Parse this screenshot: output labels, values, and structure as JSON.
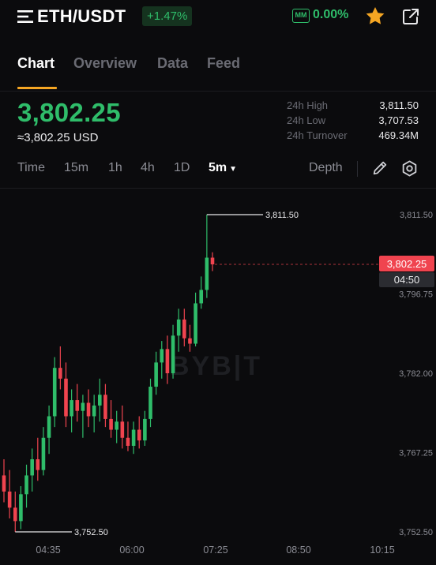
{
  "header": {
    "pair": "ETH/USDT",
    "change_pct": "+1.47%",
    "mm_label": "MM",
    "mm_value": "0.00%",
    "icons": [
      "menu-icon",
      "star-icon",
      "share-icon"
    ]
  },
  "tabs": [
    {
      "label": "Chart",
      "active": true
    },
    {
      "label": "Overview",
      "active": false
    },
    {
      "label": "Data",
      "active": false
    },
    {
      "label": "Feed",
      "active": false
    }
  ],
  "price": {
    "last": "3,802.25",
    "usd": "≈3,802.25 USD"
  },
  "stats": [
    {
      "label": "24h High",
      "value": "3,811.50"
    },
    {
      "label": "24h Low",
      "value": "3,707.53"
    },
    {
      "label": "24h Turnover",
      "value": "469.34M"
    }
  ],
  "toolbar": {
    "timeframes": [
      {
        "label": "Time",
        "active": false
      },
      {
        "label": "15m",
        "active": false
      },
      {
        "label": "1h",
        "active": false
      },
      {
        "label": "4h",
        "active": false
      },
      {
        "label": "1D",
        "active": false
      },
      {
        "label": "5m",
        "active": true
      }
    ],
    "depth_label": "Depth"
  },
  "colors": {
    "up": "#2fbd6a",
    "down": "#f0444f",
    "accent": "#f5a623",
    "background": "#0b0b0d"
  },
  "watermark": "BYB|T",
  "chart_data": {
    "type": "candlestick",
    "y_ticks": [
      "3,811.50",
      "3,796.75",
      "3,782.00",
      "3,767.25",
      "3,752.50"
    ],
    "y_tick_values": [
      3811.5,
      3796.75,
      3782.0,
      3767.25,
      3752.5
    ],
    "ylim": [
      3752.5,
      3811.5
    ],
    "x_ticks": [
      "04:35",
      "06:00",
      "07:25",
      "08:50",
      "10:15"
    ],
    "high_marker": "3,811.50",
    "low_marker": "3,752.50",
    "current_price_label": "3,802.25",
    "countdown": "04:50",
    "grid": false,
    "candles": [
      {
        "o": 3763.0,
        "h": 3766.0,
        "l": 3758.0,
        "c": 3760.0
      },
      {
        "o": 3760.0,
        "h": 3764.0,
        "l": 3755.0,
        "c": 3757.0
      },
      {
        "o": 3757.0,
        "h": 3760.0,
        "l": 3752.5,
        "c": 3754.5
      },
      {
        "o": 3754.5,
        "h": 3761.0,
        "l": 3753.0,
        "c": 3759.5
      },
      {
        "o": 3759.5,
        "h": 3765.0,
        "l": 3757.0,
        "c": 3763.0
      },
      {
        "o": 3763.0,
        "h": 3768.0,
        "l": 3760.0,
        "c": 3766.0
      },
      {
        "o": 3766.0,
        "h": 3770.0,
        "l": 3762.0,
        "c": 3764.0
      },
      {
        "o": 3764.0,
        "h": 3772.0,
        "l": 3763.0,
        "c": 3770.0
      },
      {
        "o": 3770.0,
        "h": 3776.0,
        "l": 3767.0,
        "c": 3774.0
      },
      {
        "o": 3774.0,
        "h": 3785.0,
        "l": 3772.0,
        "c": 3783.0
      },
      {
        "o": 3783.0,
        "h": 3787.0,
        "l": 3779.0,
        "c": 3781.0
      },
      {
        "o": 3781.0,
        "h": 3784.0,
        "l": 3772.0,
        "c": 3774.0
      },
      {
        "o": 3774.0,
        "h": 3779.0,
        "l": 3771.0,
        "c": 3777.0
      },
      {
        "o": 3777.0,
        "h": 3780.0,
        "l": 3773.0,
        "c": 3775.0
      },
      {
        "o": 3775.0,
        "h": 3778.0,
        "l": 3770.0,
        "c": 3776.5
      },
      {
        "o": 3776.5,
        "h": 3779.0,
        "l": 3772.0,
        "c": 3774.0
      },
      {
        "o": 3774.0,
        "h": 3778.0,
        "l": 3771.0,
        "c": 3776.0
      },
      {
        "o": 3776.0,
        "h": 3781.0,
        "l": 3773.0,
        "c": 3778.0
      },
      {
        "o": 3778.0,
        "h": 3780.0,
        "l": 3772.0,
        "c": 3773.5
      },
      {
        "o": 3773.5,
        "h": 3777.0,
        "l": 3770.0,
        "c": 3771.5
      },
      {
        "o": 3771.5,
        "h": 3775.0,
        "l": 3769.0,
        "c": 3773.0
      },
      {
        "o": 3773.0,
        "h": 3776.0,
        "l": 3768.0,
        "c": 3770.0
      },
      {
        "o": 3770.0,
        "h": 3773.0,
        "l": 3767.5,
        "c": 3768.5
      },
      {
        "o": 3768.5,
        "h": 3773.0,
        "l": 3767.0,
        "c": 3771.5
      },
      {
        "o": 3771.5,
        "h": 3774.0,
        "l": 3768.0,
        "c": 3769.5
      },
      {
        "o": 3769.5,
        "h": 3775.0,
        "l": 3768.5,
        "c": 3773.5
      },
      {
        "o": 3773.5,
        "h": 3781.0,
        "l": 3772.0,
        "c": 3779.5
      },
      {
        "o": 3779.5,
        "h": 3786.0,
        "l": 3778.0,
        "c": 3784.0
      },
      {
        "o": 3784.0,
        "h": 3788.0,
        "l": 3781.0,
        "c": 3786.5
      },
      {
        "o": 3786.5,
        "h": 3789.0,
        "l": 3780.0,
        "c": 3782.0
      },
      {
        "o": 3782.0,
        "h": 3791.0,
        "l": 3781.0,
        "c": 3789.0
      },
      {
        "o": 3789.0,
        "h": 3794.0,
        "l": 3786.0,
        "c": 3792.0
      },
      {
        "o": 3792.0,
        "h": 3794.0,
        "l": 3787.0,
        "c": 3788.5
      },
      {
        "o": 3788.5,
        "h": 3791.0,
        "l": 3786.0,
        "c": 3787.5
      },
      {
        "o": 3787.5,
        "h": 3797.0,
        "l": 3787.0,
        "c": 3795.0
      },
      {
        "o": 3795.0,
        "h": 3800.0,
        "l": 3794.0,
        "c": 3797.5
      },
      {
        "o": 3797.5,
        "h": 3811.5,
        "l": 3796.0,
        "c": 3803.5
      },
      {
        "o": 3803.5,
        "h": 3804.5,
        "l": 3801.0,
        "c": 3802.25
      }
    ]
  }
}
